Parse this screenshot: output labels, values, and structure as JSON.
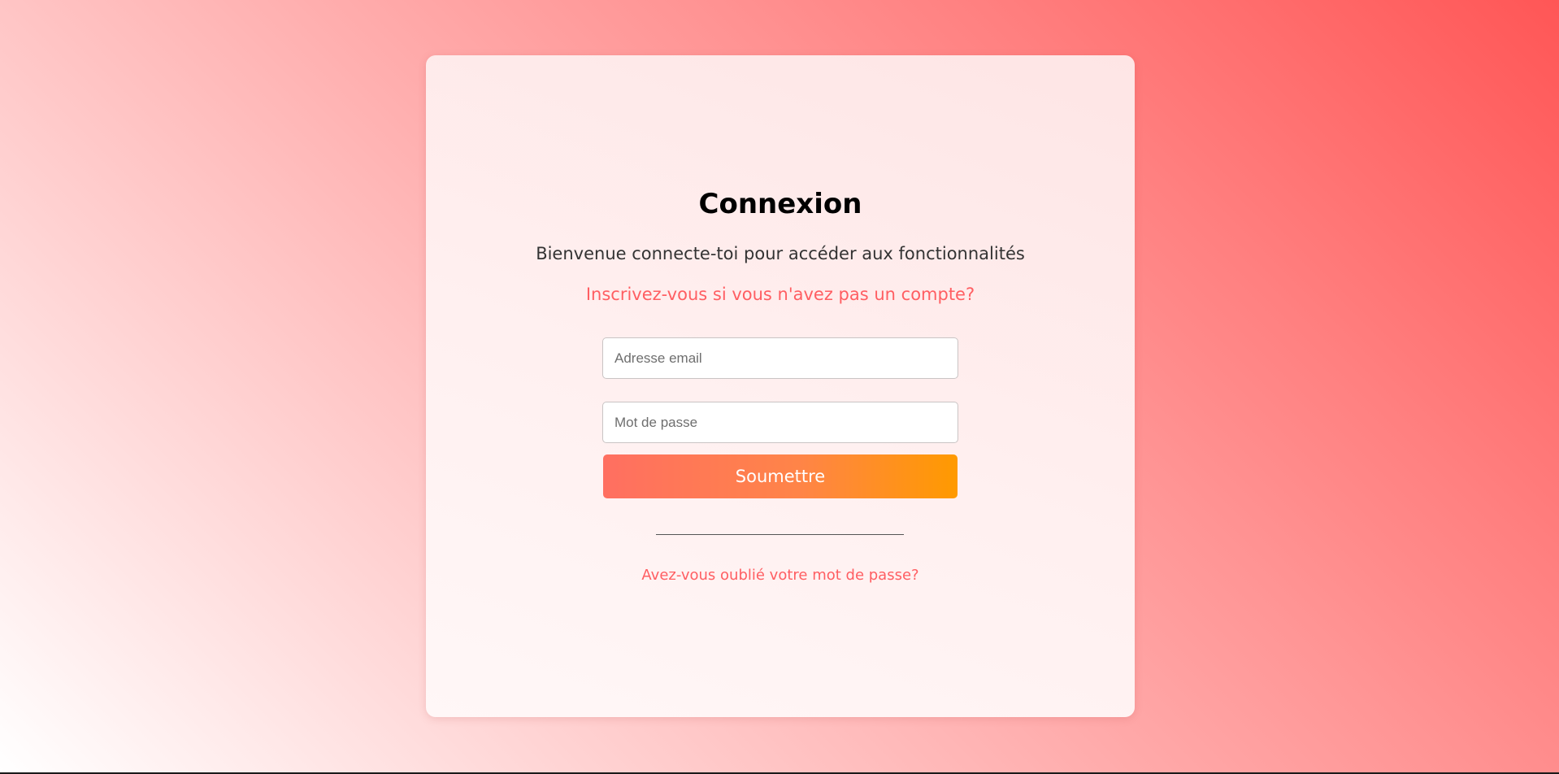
{
  "login": {
    "title": "Connexion",
    "subtitle": "Bienvenue connecte-toi pour accéder aux fonctionnalités",
    "register_link": "Inscrivez-vous si vous n'avez pas un compte?",
    "email_placeholder": "Adresse email",
    "email_value": "",
    "password_placeholder": "Mot de passe",
    "password_value": "",
    "submit_label": "Soumettre",
    "forgot_link": "Avez-vous oublié votre mot de passe?"
  },
  "colors": {
    "accent": "#ff5e62",
    "button_start": "#ff6f61",
    "button_end": "#ff9a00",
    "background_start": "#ffffff",
    "background_end": "#ff5656"
  }
}
